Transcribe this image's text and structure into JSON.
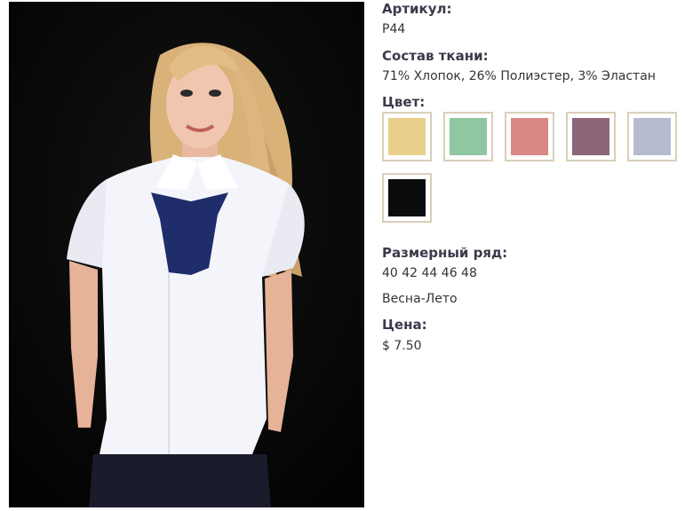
{
  "product": {
    "article_label": "Артикул:",
    "article_value": "P44",
    "composition_label": "Состав ткани:",
    "composition_value": "71% Хлопок, 26% Полиэстер, 3% Эластан",
    "color_label": "Цвет:",
    "colors": [
      {
        "name": "yellow",
        "hex": "#e8d08a"
      },
      {
        "name": "mint",
        "hex": "#8fc7a3"
      },
      {
        "name": "coral",
        "hex": "#d98886"
      },
      {
        "name": "plum",
        "hex": "#8a6678"
      },
      {
        "name": "lavender",
        "hex": "#b7bbd0"
      },
      {
        "name": "black",
        "hex": "#0c0c0f"
      }
    ],
    "size_label": "Размерный ряд:",
    "size_value": "40 42 44 46 48",
    "season_value": "Весна-Лето",
    "price_label": "Цена:",
    "price_value": "$ 7.50"
  }
}
